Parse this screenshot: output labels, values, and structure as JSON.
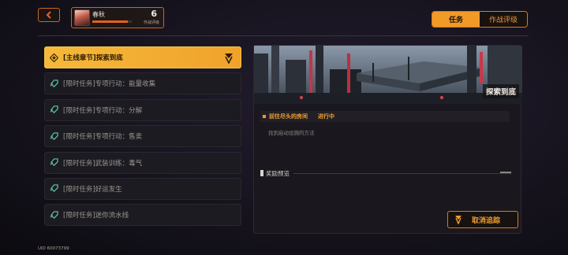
{
  "header": {
    "player_name": "春秋",
    "player_level": "6",
    "level_label": "作战评级",
    "xp_progress": 0.9
  },
  "tabs": [
    {
      "label": "任务",
      "active": true
    },
    {
      "label": "作战评级",
      "active": false
    }
  ],
  "tasks": [
    {
      "label": "[主线章节]探索到底",
      "active": true
    },
    {
      "label": "[限时任务]专项行动：能量收集",
      "active": false
    },
    {
      "label": "[限时任务]专项行动：分解",
      "active": false
    },
    {
      "label": "[限时任务]专项行动：售卖",
      "active": false
    },
    {
      "label": "[限时任务]武装训练：毒气",
      "active": false
    },
    {
      "label": "[限时任务]好运发生",
      "active": false
    },
    {
      "label": "[限时任务]迷你流水线",
      "active": false
    }
  ],
  "detail": {
    "title": "探索到底",
    "objective": "前往尽头的房间",
    "objective_status": "进行中",
    "objective_desc": "找到启动设施的方法",
    "reward_label": "奖励预览",
    "cancel_label": "取消追踪"
  },
  "footer": {
    "uid": "UID 60073799"
  },
  "colors": {
    "accent": "#f09a28",
    "accent_border": "#d87a22",
    "panel": "#1a181e"
  }
}
